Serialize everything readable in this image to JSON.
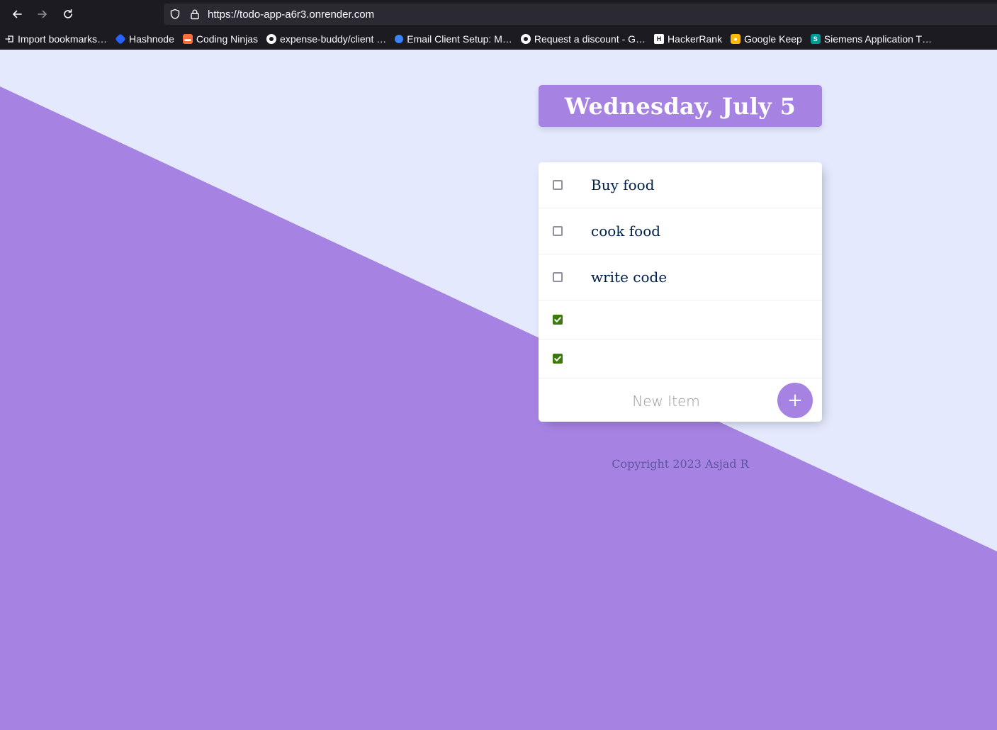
{
  "browser": {
    "url": "https://todo-app-a6r3.onrender.com",
    "bookmarks": [
      {
        "label": "Import bookmarks…",
        "icon": "import-icon",
        "color": "#fbfbfe"
      },
      {
        "label": "Hashnode",
        "icon": "hashnode-icon",
        "color": "#2962ff"
      },
      {
        "label": "Coding Ninjas",
        "icon": "coding-ninjas-icon",
        "color": "#f66c3b"
      },
      {
        "label": "expense-buddy/client …",
        "icon": "github-icon",
        "color": "#fbfbfe"
      },
      {
        "label": "Email Client Setup: M…",
        "icon": "globe-icon",
        "color": "#3b82f6"
      },
      {
        "label": "Request a discount - G…",
        "icon": "github-icon",
        "color": "#fbfbfe"
      },
      {
        "label": "HackerRank",
        "icon": "hackerrank-icon",
        "color": "#1ba94c"
      },
      {
        "label": "Google Keep",
        "icon": "google-keep-icon",
        "color": "#f9bb05"
      },
      {
        "label": "Siemens Application T…",
        "icon": "siemens-icon",
        "color": "#009999"
      }
    ]
  },
  "heading": {
    "title": "Wednesday, July 5"
  },
  "items": [
    {
      "text": "Buy food",
      "checked": false
    },
    {
      "text": "cook food",
      "checked": false
    },
    {
      "text": "write code",
      "checked": false
    },
    {
      "text": "",
      "checked": true
    },
    {
      "text": "",
      "checked": true
    }
  ],
  "new_item": {
    "placeholder": "New Item",
    "add_label": "+"
  },
  "footer": {
    "text": "Copyright 2023 Asjad R"
  },
  "colors": {
    "accent": "#A683E3",
    "background": "#E4E9FD",
    "text": "#00204a",
    "checkbox_checked": "#3c7a0c"
  }
}
